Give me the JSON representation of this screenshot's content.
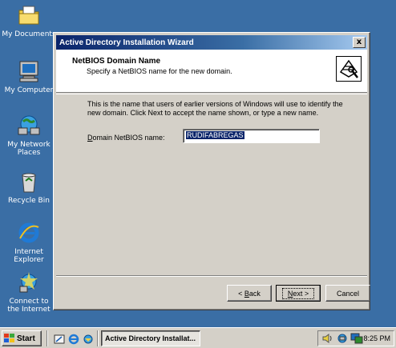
{
  "desktop": {
    "icons": [
      {
        "label": "My Documents",
        "icon": "my-documents-icon"
      },
      {
        "label": "My Computer",
        "icon": "my-computer-icon"
      },
      {
        "label_line1": "My Network",
        "label_line2": "Places",
        "icon": "network-places-icon"
      },
      {
        "label": "Recycle Bin",
        "icon": "recycle-bin-icon"
      },
      {
        "label_line1": "Internet",
        "label_line2": "Explorer",
        "icon": "internet-explorer-icon"
      },
      {
        "label_line1": "Connect to",
        "label_line2": "the Internet",
        "icon": "connect-internet-icon"
      }
    ]
  },
  "window": {
    "title": "Active Directory Installation Wizard",
    "close_label": "x",
    "header": {
      "title": "NetBIOS Domain Name",
      "subtitle": "Specify a NetBIOS name for the new domain."
    },
    "body": {
      "description": "This is the name that users of earlier versions of Windows will use to identify the new domain. Click Next to accept the name shown, or type a new name.",
      "field_label": "Domain NetBIOS name:",
      "field_value": "RUDIFABREGAS"
    },
    "buttons": {
      "back": "< Back",
      "next": "Next >",
      "cancel": "Cancel"
    }
  },
  "taskbar": {
    "start_label": "Start",
    "task_label": "Active Directory Installat...",
    "clock": "8:25 PM"
  },
  "colors": {
    "desktop": "#3a6ea5",
    "title_active": "#0a246a",
    "face": "#d4d0c8"
  }
}
